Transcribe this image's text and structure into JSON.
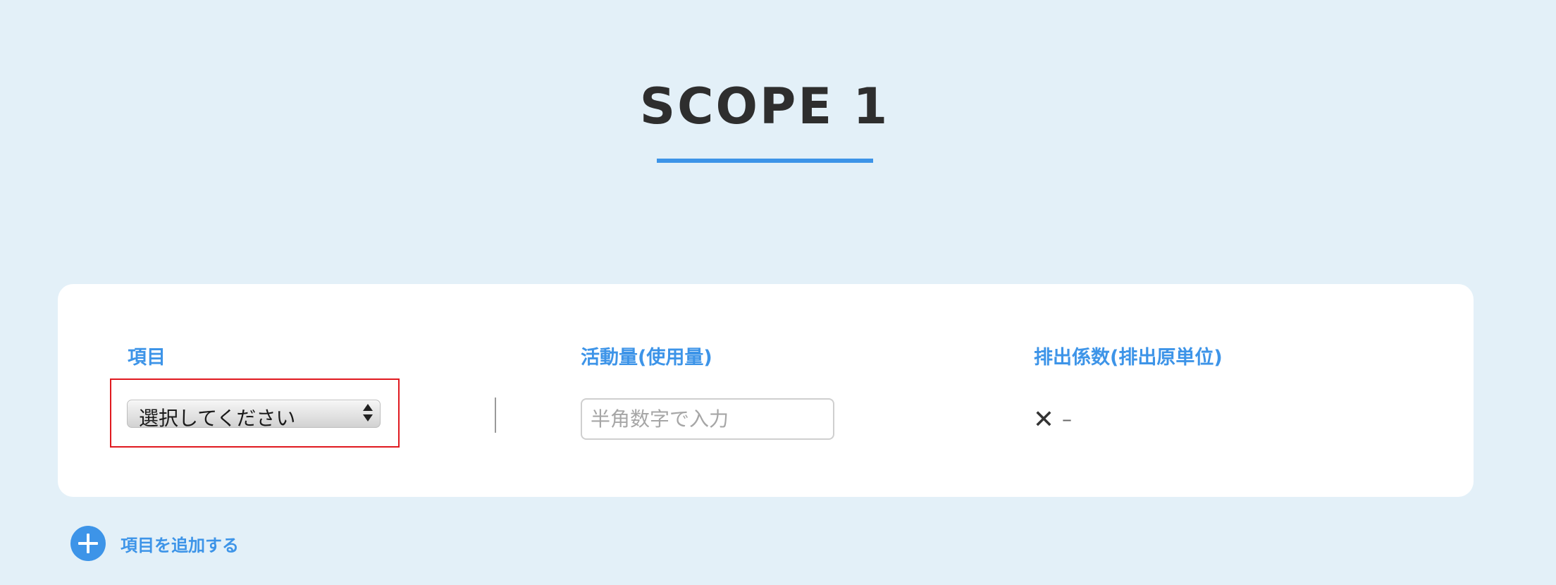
{
  "header": {
    "title": "SCOPE 1"
  },
  "columns": {
    "item_label": "項目",
    "amount_label": "活動量(使用量)",
    "factor_label": "排出係数(排出原単位)"
  },
  "row": {
    "item_select_value": "選択してください",
    "amount_placeholder": "半角数字で入力",
    "amount_value": "",
    "multiply_symbol": "✕",
    "factor_value": "–"
  },
  "actions": {
    "add_item_label": "項目を追加する"
  },
  "colors": {
    "accent": "#3d94e8",
    "background": "#e3f0f8",
    "highlight": "#e0191f"
  },
  "icons": {
    "add": "plus-circle-icon",
    "multiply": "times-icon",
    "select_arrows": "up-down-arrows-icon"
  }
}
